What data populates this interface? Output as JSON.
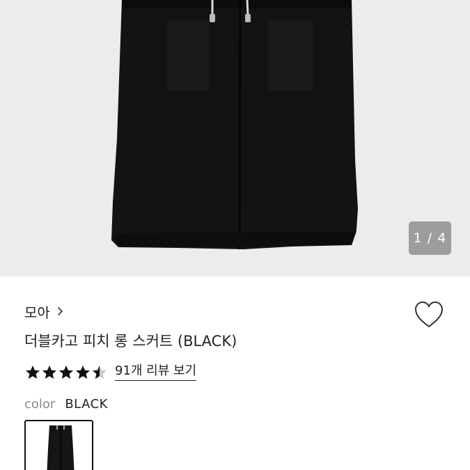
{
  "gallery": {
    "image_desc": "black-long-skirt-photo",
    "counter": "1 / 4",
    "background": "#ececec"
  },
  "product": {
    "brand": "모아",
    "title": "더블카고 피치 롱 스커트 (BLACK)",
    "rating": 4.5,
    "review_link": "91개 리뷰 보기"
  },
  "options": {
    "color_label": "color",
    "color_value": "BLACK",
    "swatches": [
      "black-skirt-thumbnail"
    ]
  },
  "icons": {
    "heart": "heart-outline-icon",
    "chevron": "chevron-right-icon",
    "star": "star-icon"
  }
}
